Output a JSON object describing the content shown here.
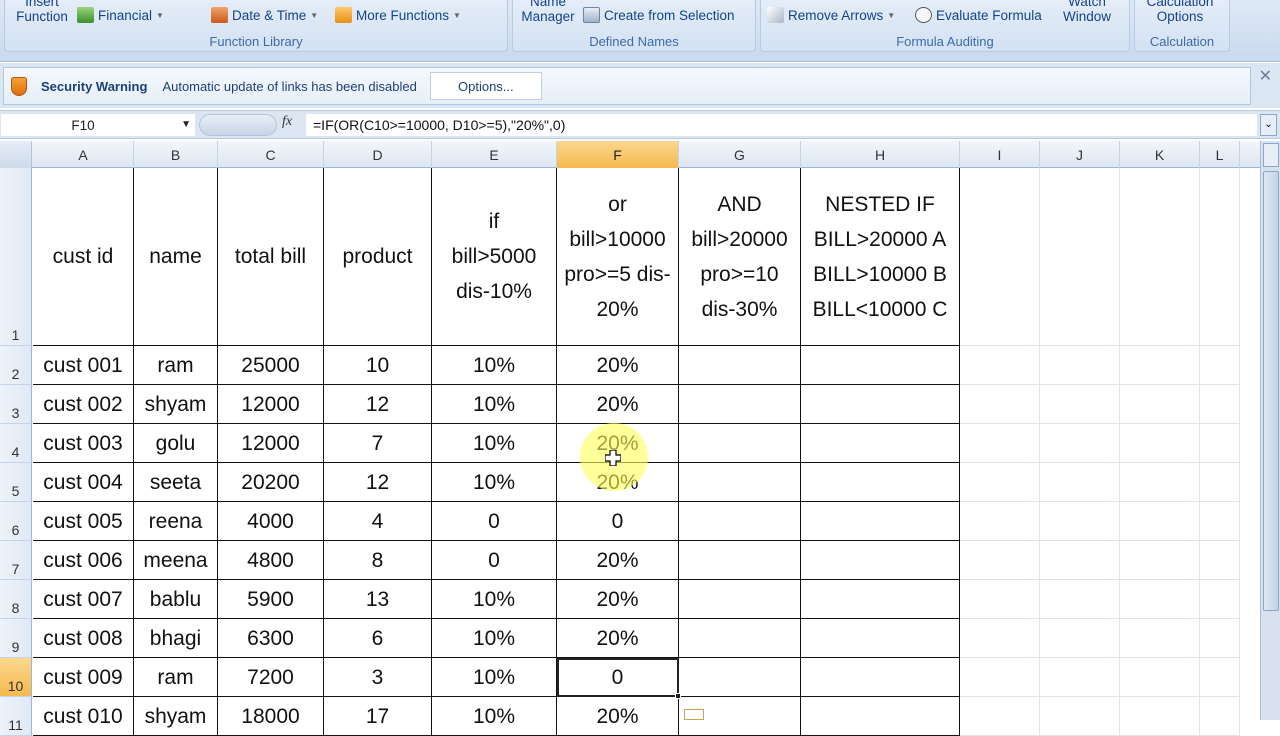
{
  "ribbon": {
    "groups": [
      {
        "label": "Function Library",
        "buttons": [
          "Insert Function",
          "Financial",
          "Date & Time",
          "More Functions"
        ]
      },
      {
        "label": "Defined Names",
        "buttons": [
          "Name Manager",
          "Create from Selection"
        ]
      },
      {
        "label": "Formula Auditing",
        "buttons": [
          "Remove Arrows",
          "Evaluate Formula",
          "Watch Window"
        ]
      },
      {
        "label": "Calculation",
        "buttons": [
          "Calculation Options"
        ]
      }
    ],
    "insert_function": "Insert Function",
    "financial": "Financial",
    "date_time": "Date & Time",
    "more_functions": "More Functions",
    "name_manager": "Name Manager",
    "create_from_selection": "Create from Selection",
    "remove_arrows": "Remove Arrows",
    "evaluate_formula": "Evaluate Formula",
    "watch_window": "Watch Window",
    "calculation_options": "Calculation Options"
  },
  "security": {
    "title": "Security Warning",
    "message": "Automatic update of links has been disabled",
    "options_label": "Options..."
  },
  "formula_bar": {
    "name_box": "F10",
    "fx": "fx",
    "formula": "=IF(OR(C10>=10000, D10>=5),\"20%\",0)"
  },
  "columns": [
    "A",
    "B",
    "C",
    "D",
    "E",
    "F",
    "G",
    "H",
    "I",
    "J",
    "K",
    "L"
  ],
  "selected_column": "F",
  "selected_row": "10",
  "selected_cell": "F10",
  "rows": [
    "1",
    "2",
    "3",
    "4",
    "5",
    "6",
    "7",
    "8",
    "9",
    "10",
    "11"
  ],
  "header_row": {
    "A": "cust id",
    "B": "name",
    "C": "total bill",
    "D": "product",
    "E": [
      "if",
      "bill>5000",
      "dis-10%"
    ],
    "F": [
      "or",
      "bill>10000",
      "pro>=5 dis-",
      "20%"
    ],
    "G": [
      "AND",
      "bill>20000",
      "pro>=10",
      "dis-30%"
    ],
    "H": [
      "NESTED IF",
      "BILL>20000 A",
      "BILL>10000 B",
      "BILL<10000 C"
    ]
  },
  "data_rows": [
    [
      "cust 001",
      "ram",
      "25000",
      "10",
      "10%",
      "20%",
      "",
      ""
    ],
    [
      "cust 002",
      "shyam",
      "12000",
      "12",
      "10%",
      "20%",
      "",
      ""
    ],
    [
      "cust 003",
      "golu",
      "12000",
      "7",
      "10%",
      "20%",
      "",
      ""
    ],
    [
      "cust 004",
      "seeta",
      "20200",
      "12",
      "10%",
      "20%",
      "",
      ""
    ],
    [
      "cust 005",
      "reena",
      "4000",
      "4",
      "0",
      "0",
      "",
      ""
    ],
    [
      "cust 006",
      "meena",
      "4800",
      "8",
      "0",
      "20%",
      "",
      ""
    ],
    [
      "cust 007",
      "bablu",
      "5900",
      "13",
      "10%",
      "20%",
      "",
      ""
    ],
    [
      "cust 008",
      "bhagi",
      "6300",
      "6",
      "10%",
      "20%",
      "",
      ""
    ],
    [
      "cust 009",
      "ram",
      "7200",
      "3",
      "10%",
      "0",
      "",
      ""
    ],
    [
      "cust 010",
      "shyam",
      "18000",
      "17",
      "10%",
      "20%",
      "",
      ""
    ]
  ]
}
